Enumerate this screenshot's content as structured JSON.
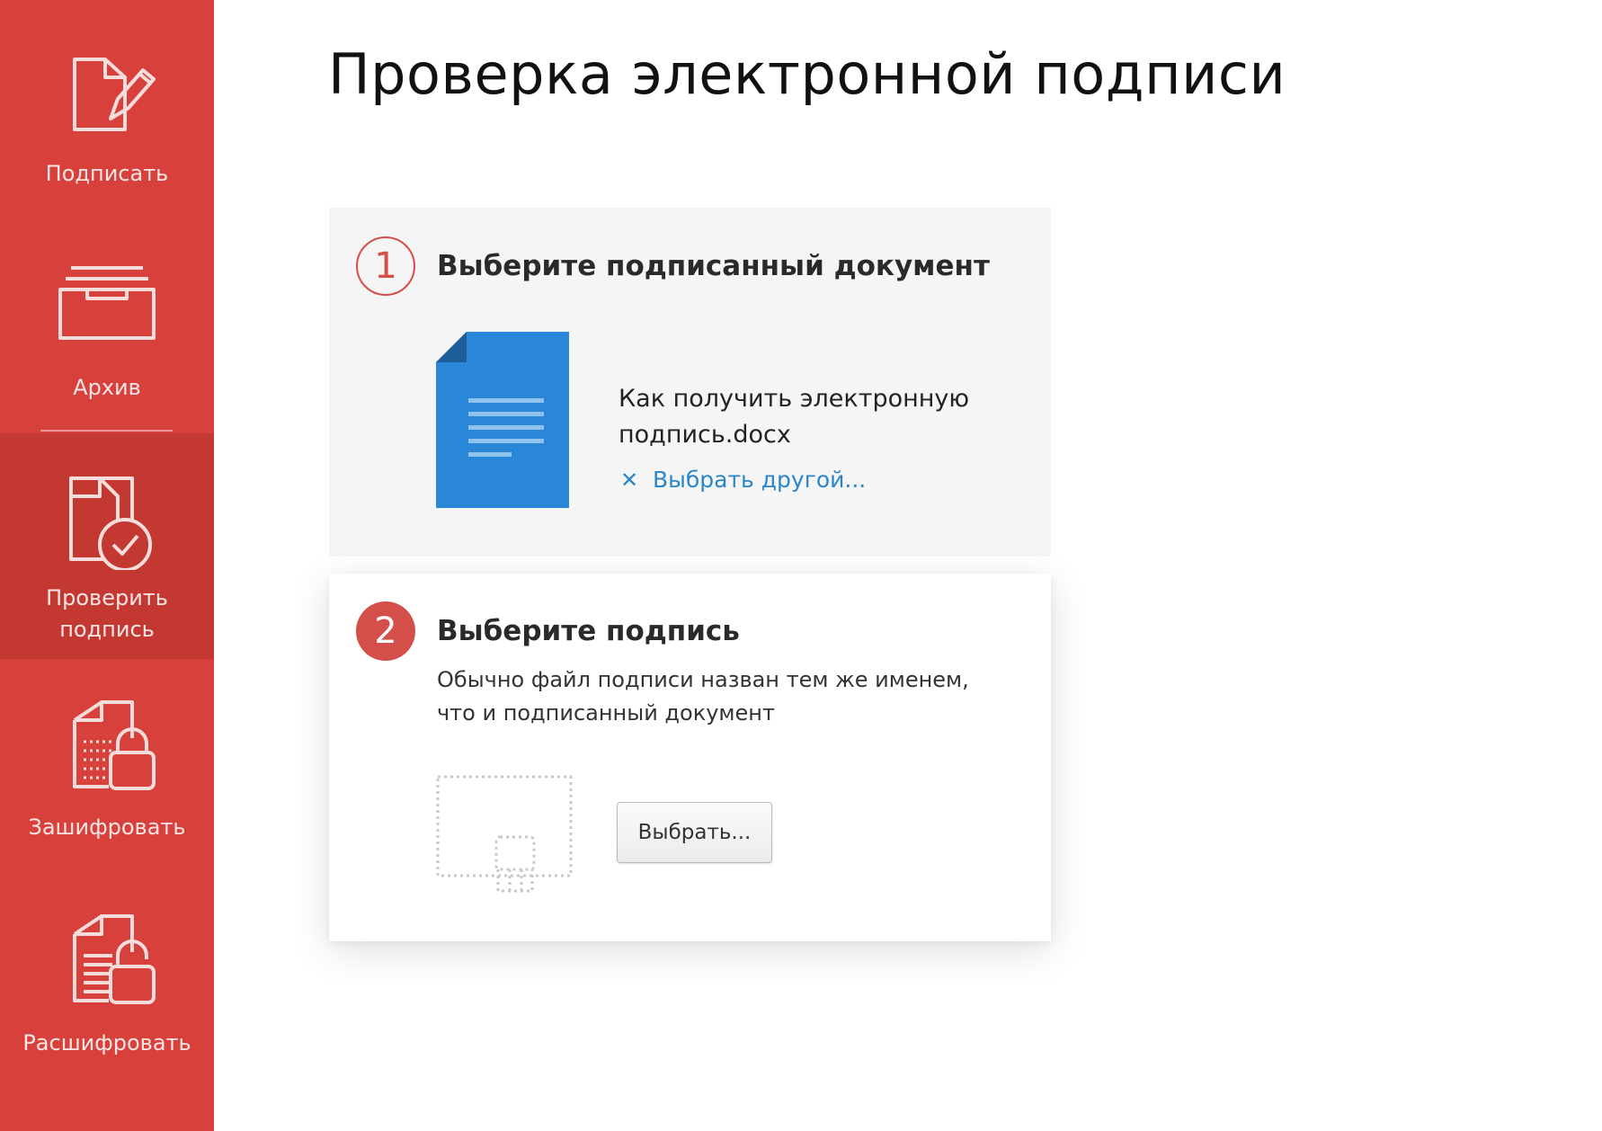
{
  "app": {
    "title": "Проверка электронной подписи"
  },
  "colors": {
    "sidebar": "#d8403c",
    "sidebar_active": "#c43832",
    "accent": "#d44e4a",
    "link": "#2a86c9",
    "document_icon": "#2a86d6"
  },
  "sidebar": {
    "items": [
      {
        "id": "sign",
        "label": "Подписать",
        "icon": "sign-document-icon",
        "active": false
      },
      {
        "id": "archive",
        "label": "Архив",
        "icon": "archive-tray-icon",
        "active": false
      },
      {
        "id": "verify",
        "label": "Проверить\nподпись",
        "icon": "verify-document-icon",
        "active": true
      },
      {
        "id": "encrypt",
        "label": "Зашифровать",
        "icon": "encrypt-lock-icon",
        "active": false
      },
      {
        "id": "decrypt",
        "label": "Расшифровать",
        "icon": "decrypt-unlock-icon",
        "active": false
      }
    ]
  },
  "steps": {
    "document": {
      "number": "1",
      "title": "Выберите подписанный документ",
      "file_name": "Как получить электронную подпись.docx",
      "file_icon": "word-document-icon",
      "choose_other_label": "Выбрать другой..."
    },
    "signature": {
      "number": "2",
      "title": "Выберите подпись",
      "hint": "Обычно файл подписи назван тем же именем, что и подписанный документ",
      "placeholder_icon": "signature-file-placeholder-icon",
      "choose_button_label": "Выбрать..."
    }
  }
}
